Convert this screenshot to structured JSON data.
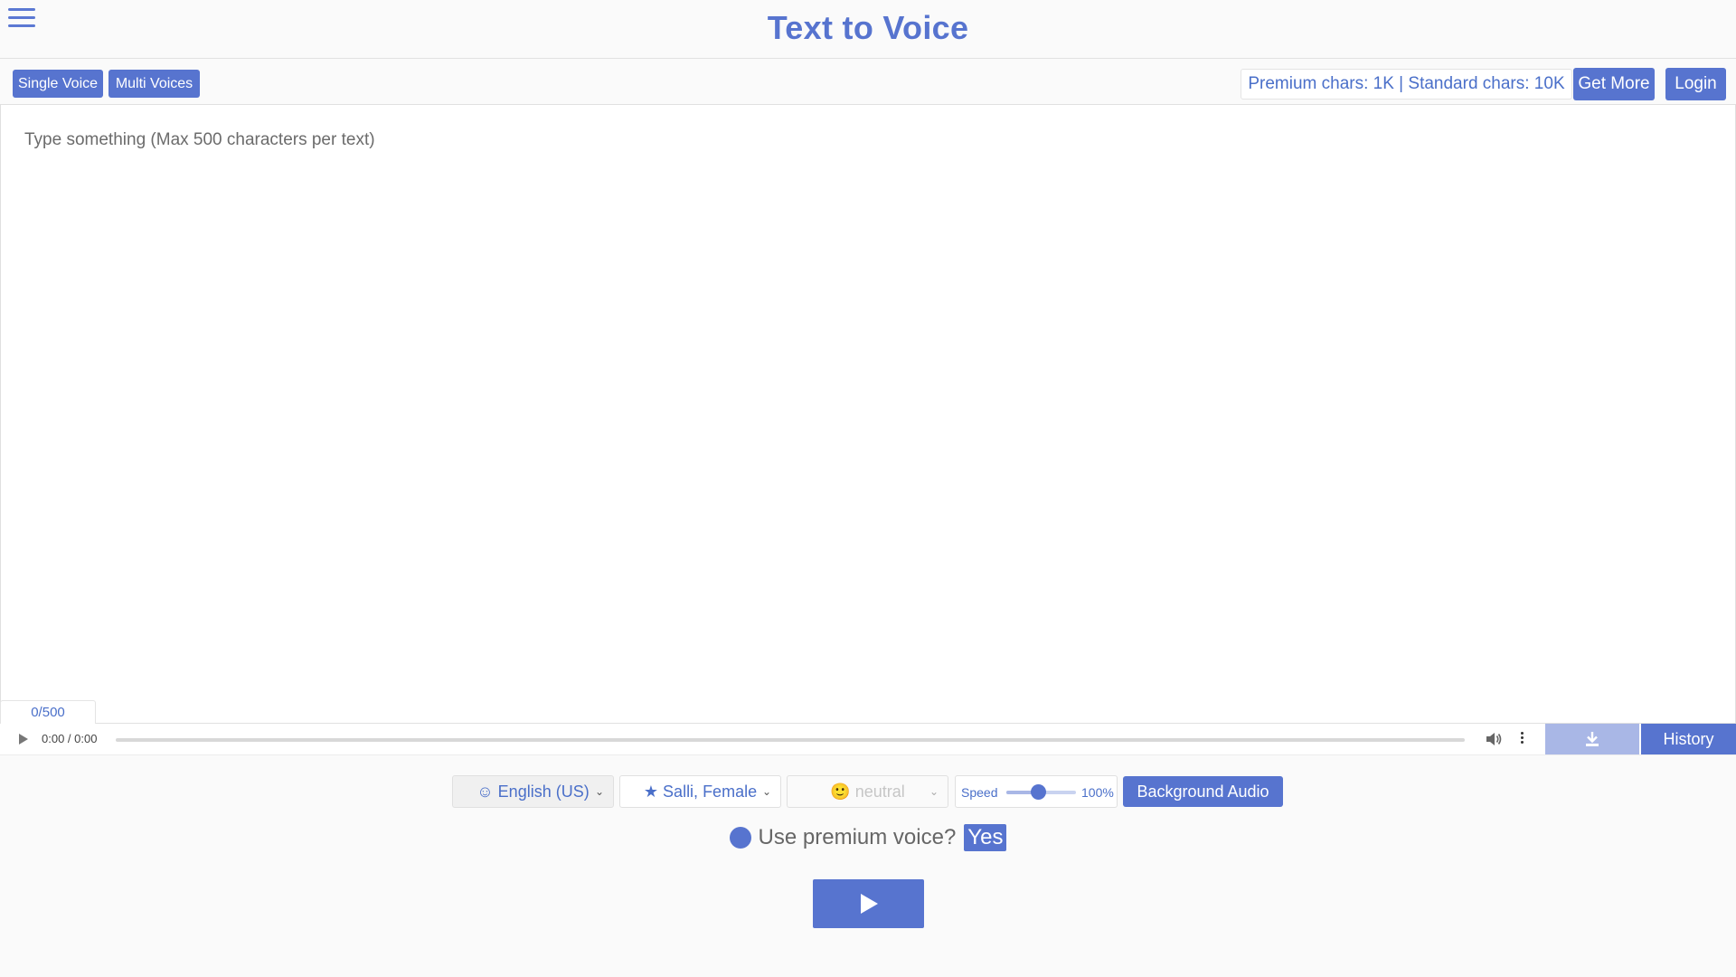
{
  "header": {
    "title": "Text to Voice"
  },
  "toolbar": {
    "single_voice": "Single Voice",
    "multi_voices": "Multi Voices",
    "chars_info": "Premium chars: 1K | Standard chars: 10K",
    "get_more": "Get More",
    "login": "Login"
  },
  "editor": {
    "value": "",
    "placeholder": "Type something (Max 500 characters per text)",
    "counter": "0/500"
  },
  "audio": {
    "time": "0:00 / 0:00",
    "history": "History"
  },
  "controls": {
    "language": "English (US)",
    "voice": "Salli, Female",
    "emotion": "neutral",
    "speed_label": "Speed",
    "speed_value": "100%",
    "speed_level": 0.45,
    "background_audio": "Background Audio",
    "premium_question": "Use premium voice?",
    "premium_answer": "Yes"
  },
  "icons": {
    "menu": "hamburger-menu-icon",
    "language": "smiley-icon",
    "voice": "star-icon",
    "emotion": "neutral-face-icon",
    "audio_play": "play-icon",
    "volume": "speaker-icon",
    "more": "kebab-icon",
    "download": "download-icon",
    "generate": "play-icon"
  },
  "colors": {
    "accent": "#5774cf",
    "accent_light": "#a9b7e6",
    "text_link": "#4a6fc9"
  }
}
